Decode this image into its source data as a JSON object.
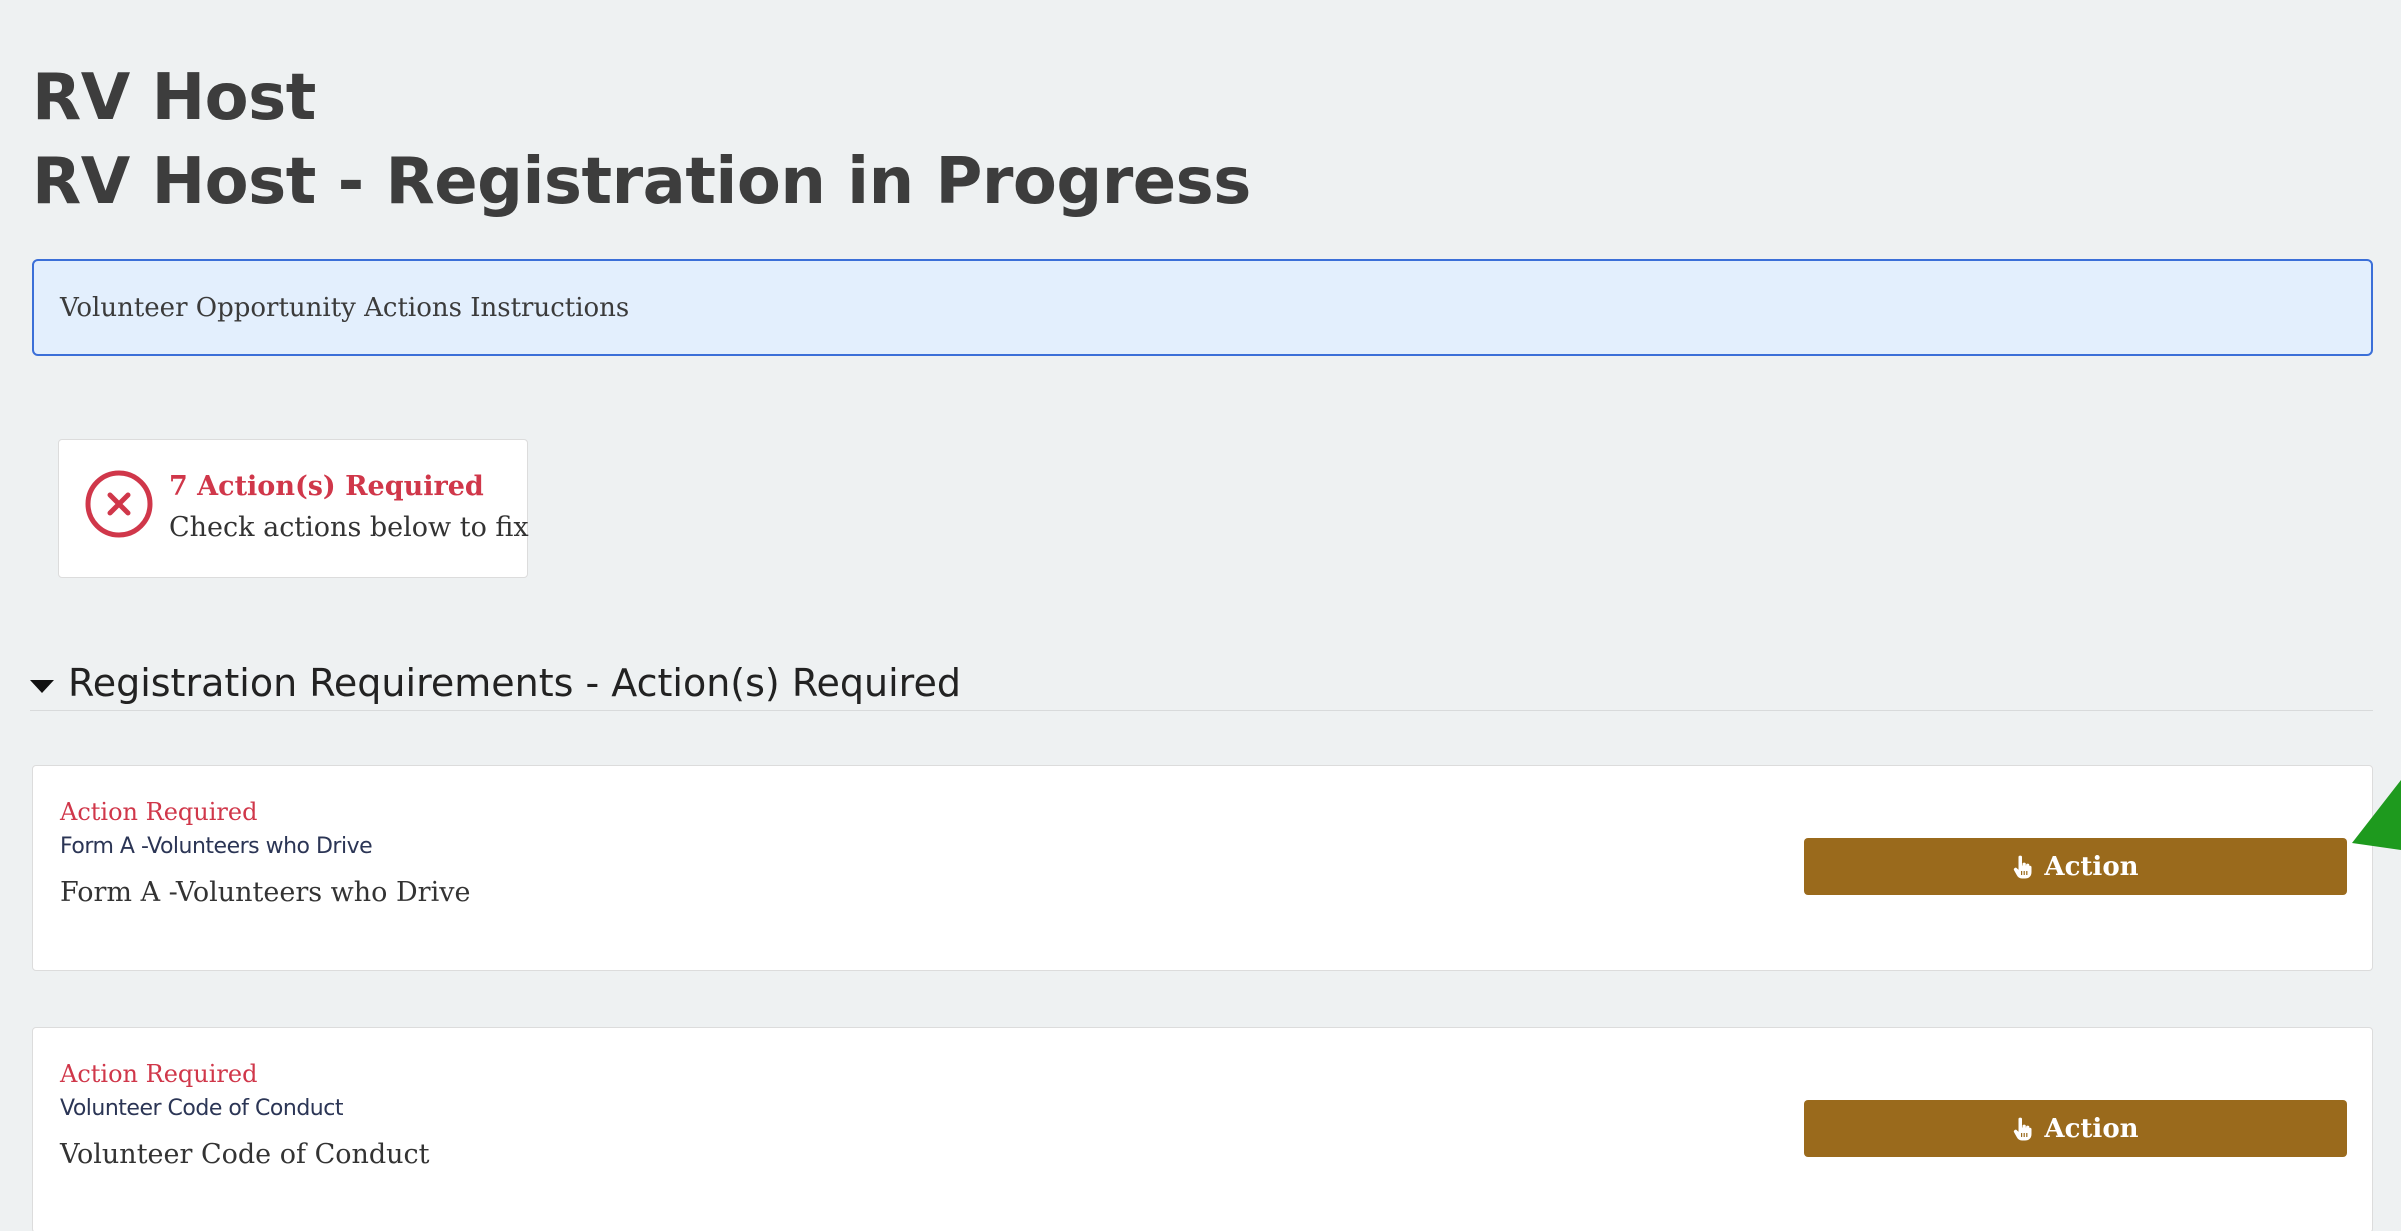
{
  "page": {
    "title_line1": "RV Host",
    "title_line2": "RV Host - Registration in Progress"
  },
  "instructions": {
    "label": "Volunteer Opportunity Actions Instructions"
  },
  "status": {
    "title": "7 Action(s) Required",
    "subtitle": "Check actions below to fix",
    "icon": "x-circle-icon",
    "color": "#d0374a"
  },
  "section": {
    "title": "Registration Requirements - Action(s) Required",
    "icon": "caret-down-icon"
  },
  "requirements": [
    {
      "status": "Action Required",
      "title": "Form A -Volunteers who Drive",
      "description": "Form A -Volunteers who Drive",
      "button_label": "Action"
    },
    {
      "status": "Action Required",
      "title": "Volunteer Code of Conduct",
      "description": "Volunteer Code of Conduct",
      "button_label": "Action"
    }
  ],
  "colors": {
    "background": "#eef1f2",
    "action_button": "#9a6a1c",
    "error": "#d0374a",
    "info_border": "#3b6fd8",
    "info_background": "#e3effd",
    "pointer_arrow": "#1e9a1e"
  }
}
